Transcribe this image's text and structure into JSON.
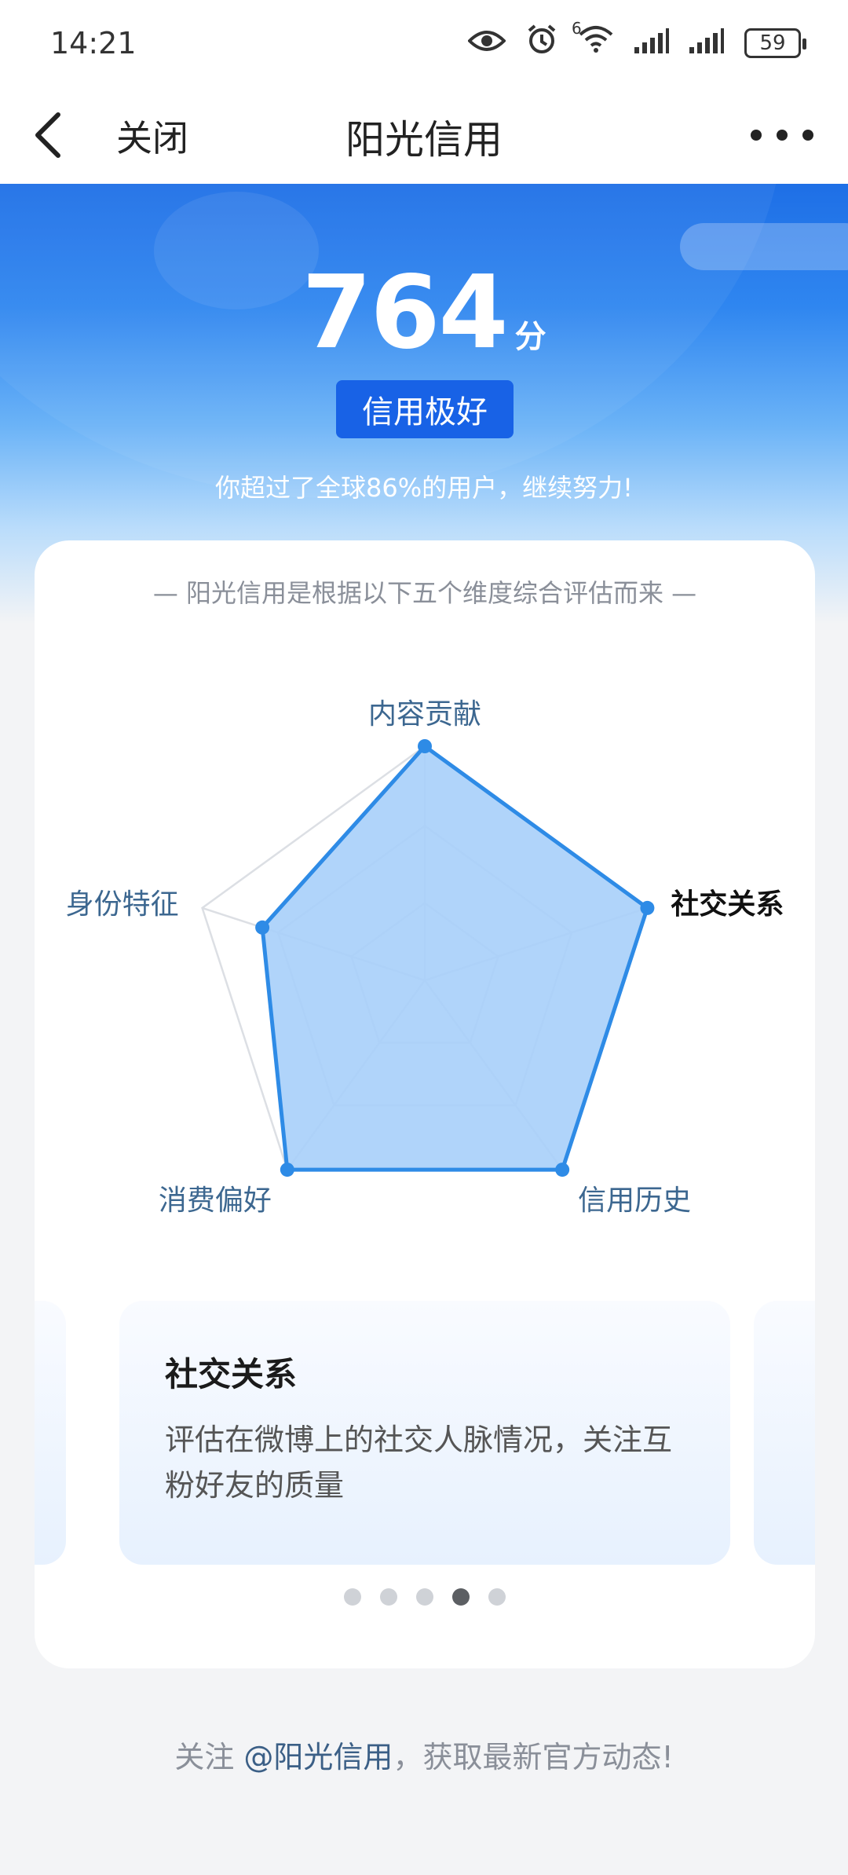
{
  "status_bar": {
    "time": "14:21",
    "icons": [
      "eye-icon",
      "alarm-icon",
      "wifi-icon",
      "signal-icon",
      "signal-icon"
    ],
    "wifi_badge": "6",
    "battery": "59"
  },
  "nav": {
    "close_label": "关闭",
    "title": "阳光信用"
  },
  "hero": {
    "score": "764",
    "score_unit": "分",
    "rating": "信用极好",
    "note": "你超过了全球86%的用户，继续努力!"
  },
  "card": {
    "caption": "— 阳光信用是根据以下五个维度综合评估而来 —",
    "radar": {
      "dimensions": [
        "内容贡献",
        "社交关系",
        "信用历史",
        "消费偏好",
        "身份特征"
      ],
      "values": [
        1.0,
        1.0,
        1.0,
        1.0,
        0.73
      ],
      "active_dimension": "社交关系",
      "fill_color": "#a7cffa",
      "line_color": "#2e8be6"
    },
    "slides": [
      {
        "title": "社交关系",
        "desc": "评估在微博上的社交人脉情况，关注互粉好友的质量"
      }
    ],
    "page_count": 5,
    "active_page": 4
  },
  "footer": {
    "prefix": "关注 ",
    "mention": "@阳光信用",
    "suffix": "，获取最新官方动态!"
  }
}
